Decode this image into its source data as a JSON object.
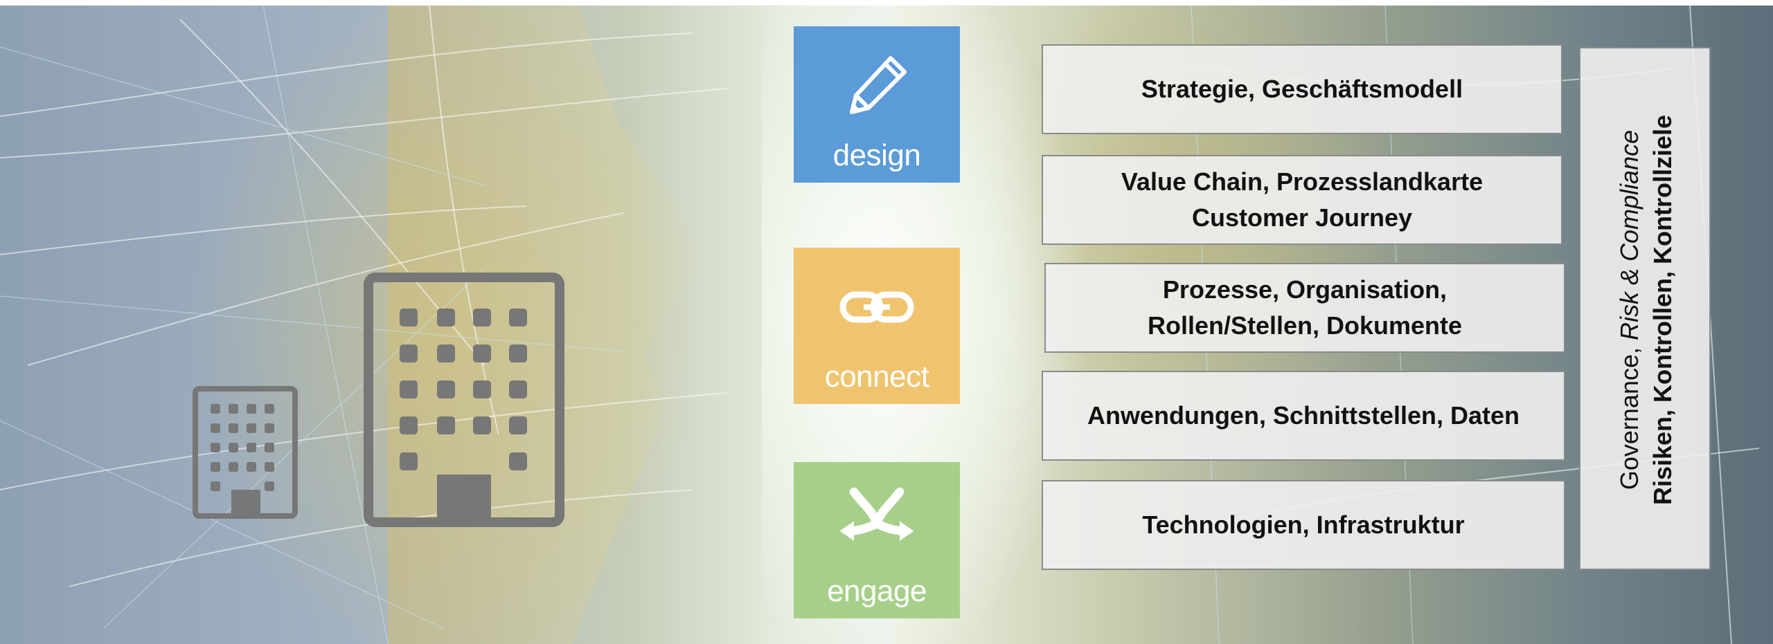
{
  "tiles": [
    {
      "label": "design",
      "icon": "pencil-icon",
      "color": "#5b9bd8"
    },
    {
      "label": "connect",
      "icon": "chain-link-icon",
      "color": "#f0c46f"
    },
    {
      "label": "engage",
      "icon": "merge-arrows-icon",
      "color": "#a6d08a"
    }
  ],
  "layers": [
    {
      "lines": [
        "Strategie, Geschäftsmodell"
      ]
    },
    {
      "lines": [
        "Value Chain, Prozesslandkarte",
        "Customer Journey"
      ]
    },
    {
      "lines": [
        "Prozesse, Organisation,",
        "Rollen/Stellen, Dokumente"
      ]
    },
    {
      "lines": [
        "Anwendungen, Schnittstellen, Daten"
      ]
    },
    {
      "lines": [
        "Technologien, Infrastruktur"
      ]
    }
  ],
  "grc": {
    "line1_a": "Governance, ",
    "line1_b": "Risk & Compliance",
    "line2": "Risiken, Kontrollen, Kontrollziele"
  },
  "icons": {
    "small_building": "building-icon",
    "large_building": "building-icon"
  },
  "colors": {
    "building": "#777777",
    "box_border": "#8a8a8a"
  }
}
